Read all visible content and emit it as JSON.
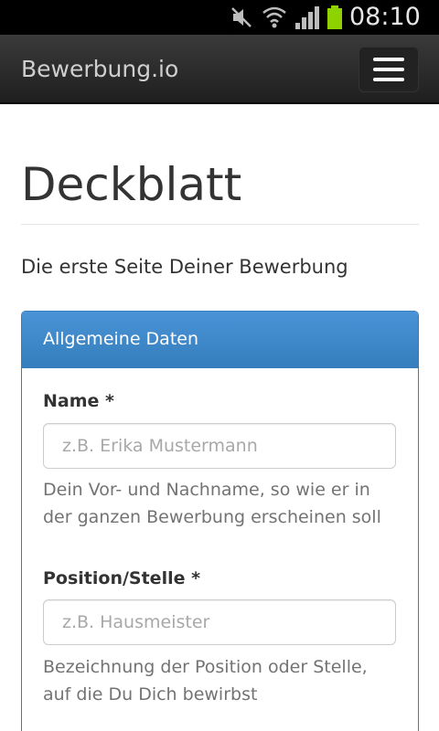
{
  "status_bar": {
    "time": "08:10",
    "icons": [
      "mute-icon",
      "wifi-icon",
      "signal-icon",
      "battery-icon"
    ]
  },
  "navbar": {
    "brand": "Bewerbung.io",
    "menu_icon": "hamburger-menu-icon"
  },
  "page": {
    "title": "Deckblatt",
    "lead": "Die erste Seite Deiner Bewerbung"
  },
  "panel": {
    "heading": "Allgemeine Daten",
    "fields": [
      {
        "label": "Name *",
        "placeholder": "z.B. Erika Mustermann",
        "value": "",
        "help": "Dein Vor- und Nachname, so wie er in der ganzen Bewerbung erscheinen soll"
      },
      {
        "label": "Position/Stelle *",
        "placeholder": "z.B. Hausmeister",
        "value": "",
        "help": "Bezeichnung der Position oder Stelle, auf die Du Dich bewirbst"
      }
    ]
  },
  "colors": {
    "navbar_bg": "#222222",
    "panel_primary": "#428bca",
    "panel_border": "#357ebd",
    "battery_green": "#8ed200"
  }
}
